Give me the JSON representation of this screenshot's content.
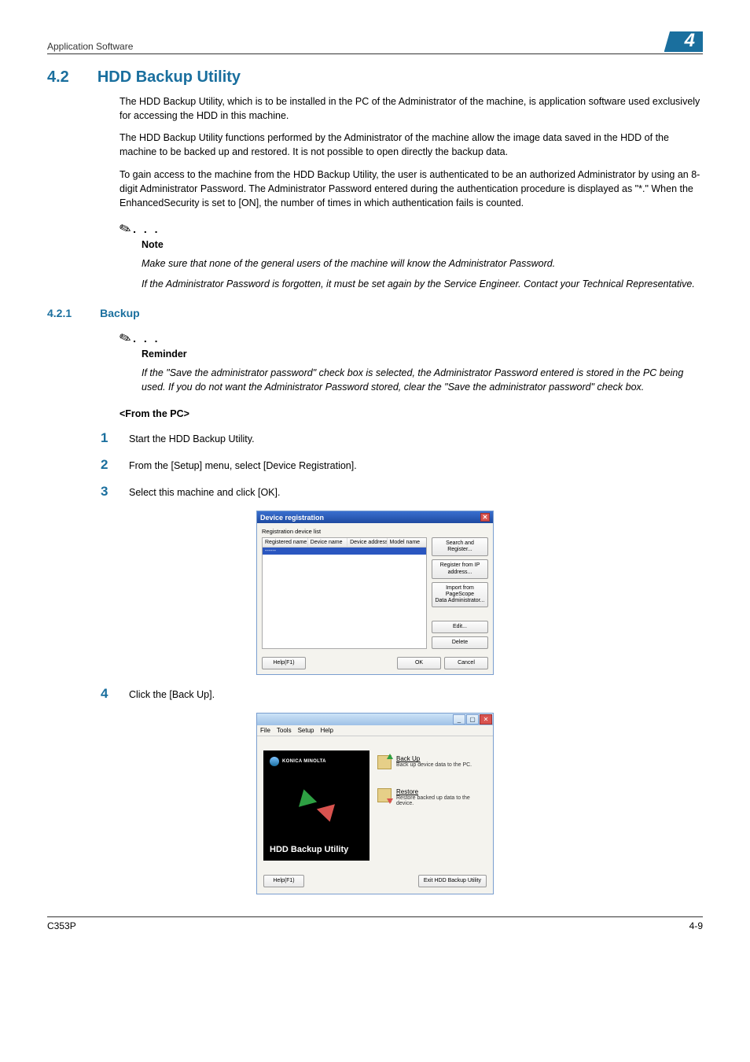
{
  "header": {
    "left": "Application Software",
    "right": "4"
  },
  "section": {
    "num": "4.2",
    "title": "HDD Backup Utility",
    "p1": "The HDD Backup Utility, which is to be installed in the PC of the Administrator of the machine, is application software used exclusively for accessing the HDD in this machine.",
    "p2": "The HDD Backup Utility functions performed by the Administrator of the machine allow the image data saved in the HDD of the machine to be backed up and restored. It is not possible to open directly the backup data.",
    "p3": "To gain access to the machine from the HDD Backup Utility, the user is authenticated to be an authorized Administrator by using an 8-digit Administrator Password. The Administrator Password entered during the authentication procedure is displayed as \"*.\" When the EnhancedSecurity is set to [ON], the number of times in which authentication fails is counted."
  },
  "note": {
    "label": "Note",
    "l1": "Make sure that none of the general users of the machine will know the Administrator Password.",
    "l2": "If the Administrator Password is forgotten, it must be set again by the Service Engineer. Contact your Technical Representative."
  },
  "sub": {
    "num": "4.2.1",
    "title": "Backup"
  },
  "reminder": {
    "label": "Reminder",
    "text": "If the \"Save the administrator password\" check box is selected, the Administrator Password entered is stored in the PC being used. If you do not want the Administrator Password stored, clear the \"Save the administrator password\" check box."
  },
  "from_pc": "<From the PC>",
  "steps": {
    "s1": "Start the HDD Backup Utility.",
    "s2": "From the [Setup] menu, select [Device Registration].",
    "s3": "Select this machine and click [OK].",
    "s4": "Click the [Back Up]."
  },
  "dialog": {
    "title": "Device registration",
    "group": "Registration device list",
    "cols": {
      "c1": "Registered name",
      "c2": "Device name",
      "c3": "Device address",
      "c4": "Model name"
    },
    "row1": "------",
    "btns": {
      "search": "Search and Register...",
      "ip": "Register from IP address...",
      "import": "Import from\nPageScope\nData Administrator...",
      "edit": "Edit...",
      "delete": "Delete",
      "help": "Help(F1)",
      "ok": "OK",
      "cancel": "Cancel"
    }
  },
  "app": {
    "menu": {
      "file": "File",
      "tools": "Tools",
      "setup": "Setup",
      "help": "Help"
    },
    "brand": "KONICA MINOLTA",
    "left_title": "HDD Backup Utility",
    "backup": {
      "title": "Back Up",
      "sub": "Back up device data to the PC."
    },
    "restore": {
      "title": "Restore",
      "sub": "Restore backed up data to the device."
    },
    "help_btn": "Help(F1)",
    "exit_btn": "Exit HDD Backup Utility"
  },
  "footer": {
    "left": "C353P",
    "right": "4-9"
  }
}
